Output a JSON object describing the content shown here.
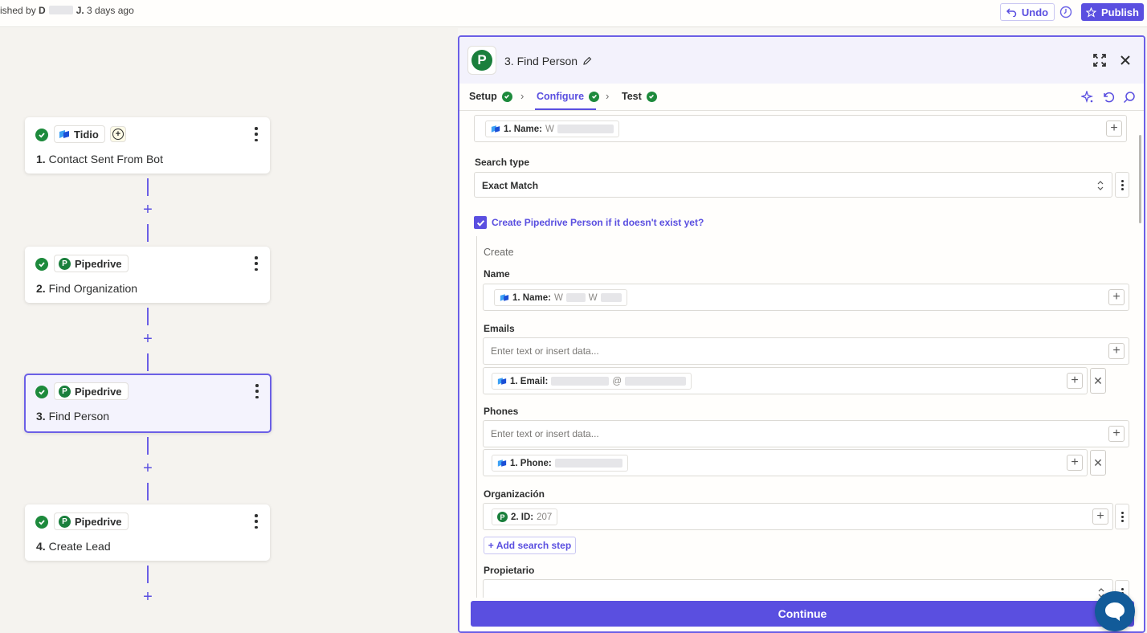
{
  "topbar": {
    "published_prefix": "ished by ",
    "published_name_initial": "D",
    "published_name_last": "J.",
    "published_time": " 3 days ago",
    "undo_label": "Undo",
    "publish_label": "Publish"
  },
  "workflow": {
    "steps": [
      {
        "app": "Tidio",
        "number": "1.",
        "title": "Contact Sent From Bot"
      },
      {
        "app": "Pipedrive",
        "number": "2.",
        "title": "Find Organization"
      },
      {
        "app": "Pipedrive",
        "number": "3.",
        "title": "Find Person"
      },
      {
        "app": "Pipedrive",
        "number": "4.",
        "title": "Create Lead"
      }
    ]
  },
  "panel": {
    "title": "3. Find Person",
    "tabs": [
      {
        "label": "Setup"
      },
      {
        "label": "Configure"
      },
      {
        "label": "Test"
      }
    ],
    "top_field": {
      "token_label": "1. Name:",
      "token_value": "W"
    },
    "search_type": {
      "label": "Search type",
      "value": "Exact Match"
    },
    "create_checkbox_label": "Create Pipedrive Person if it doesn't exist yet?",
    "create_title": "Create",
    "name": {
      "label": "Name",
      "token_label": "1. Name:",
      "token_value": "W",
      "token_value2": "W"
    },
    "emails": {
      "label": "Emails",
      "placeholder": "Enter text or insert data...",
      "token_label": "1. Email:",
      "token_value": "@"
    },
    "phones": {
      "label": "Phones",
      "placeholder": "Enter text or insert data...",
      "token_label": "1. Phone:"
    },
    "organizacion": {
      "label": "Organización",
      "token_label": "2. ID:",
      "token_value": "207"
    },
    "add_search_step_label": "Add search step",
    "propietario": {
      "label": "Propietario"
    },
    "continue_label": "Continue"
  },
  "colors": {
    "accent": "#5a4fe0",
    "success": "#1d8a3c",
    "pipedrive": "#1a7f3c",
    "chat": "#125b99"
  }
}
